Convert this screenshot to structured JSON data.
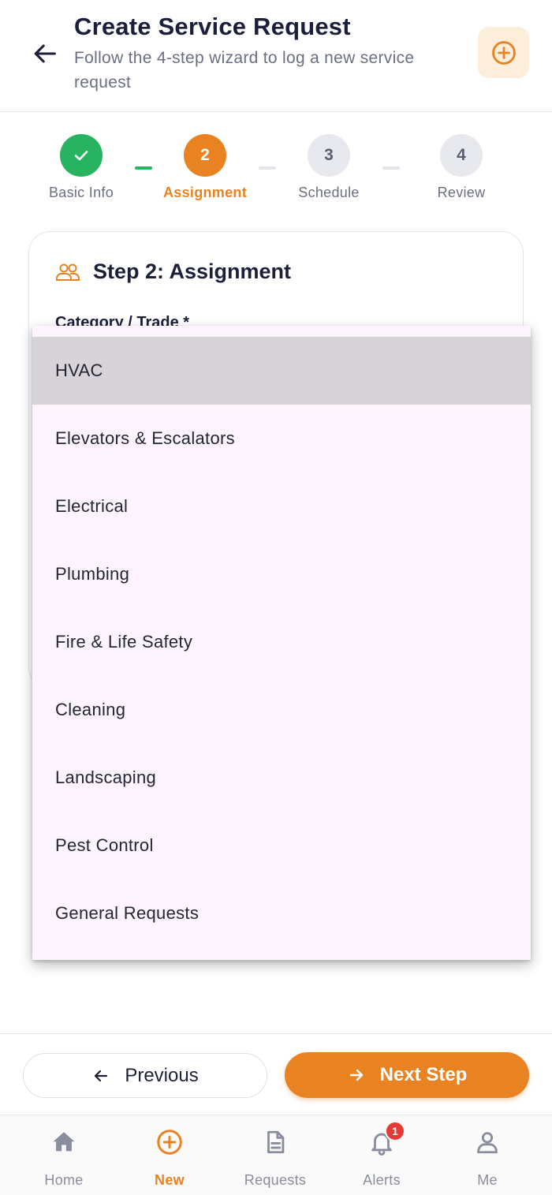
{
  "header": {
    "title": "Create Service Request",
    "subtitle": "Follow the 4-step wizard to log a new service request"
  },
  "stepper": {
    "steps": [
      {
        "number": "1",
        "label": "Basic Info",
        "state": "done"
      },
      {
        "number": "2",
        "label": "Assignment",
        "state": "active"
      },
      {
        "number": "3",
        "label": "Schedule",
        "state": "todo"
      },
      {
        "number": "4",
        "label": "Review",
        "state": "todo"
      }
    ]
  },
  "card": {
    "title": "Step 2: Assignment",
    "field_label": "Category / Trade *"
  },
  "dropdown": {
    "selected": "HVAC",
    "options": [
      "HVAC",
      "Elevators & Escalators",
      "Electrical",
      "Plumbing",
      "Fire & Life Safety",
      "Cleaning",
      "Landscaping",
      "Pest Control",
      "General Requests"
    ]
  },
  "footer": {
    "previous_label": "Previous",
    "next_label": "Next Step"
  },
  "bottom_nav": {
    "items": [
      {
        "label": "Home",
        "icon": "home-icon"
      },
      {
        "label": "New",
        "icon": "add-circle-icon",
        "active": true
      },
      {
        "label": "Requests",
        "icon": "document-icon"
      },
      {
        "label": "Alerts",
        "icon": "bell-icon",
        "badge": "1"
      },
      {
        "label": "Me",
        "icon": "person-icon"
      }
    ]
  },
  "colors": {
    "accent": "#e98321",
    "success": "#27b35f",
    "badge": "#e53935",
    "dropdown_bg": "#fdf4fd",
    "selected_option_bg": "#d8d3d9"
  }
}
